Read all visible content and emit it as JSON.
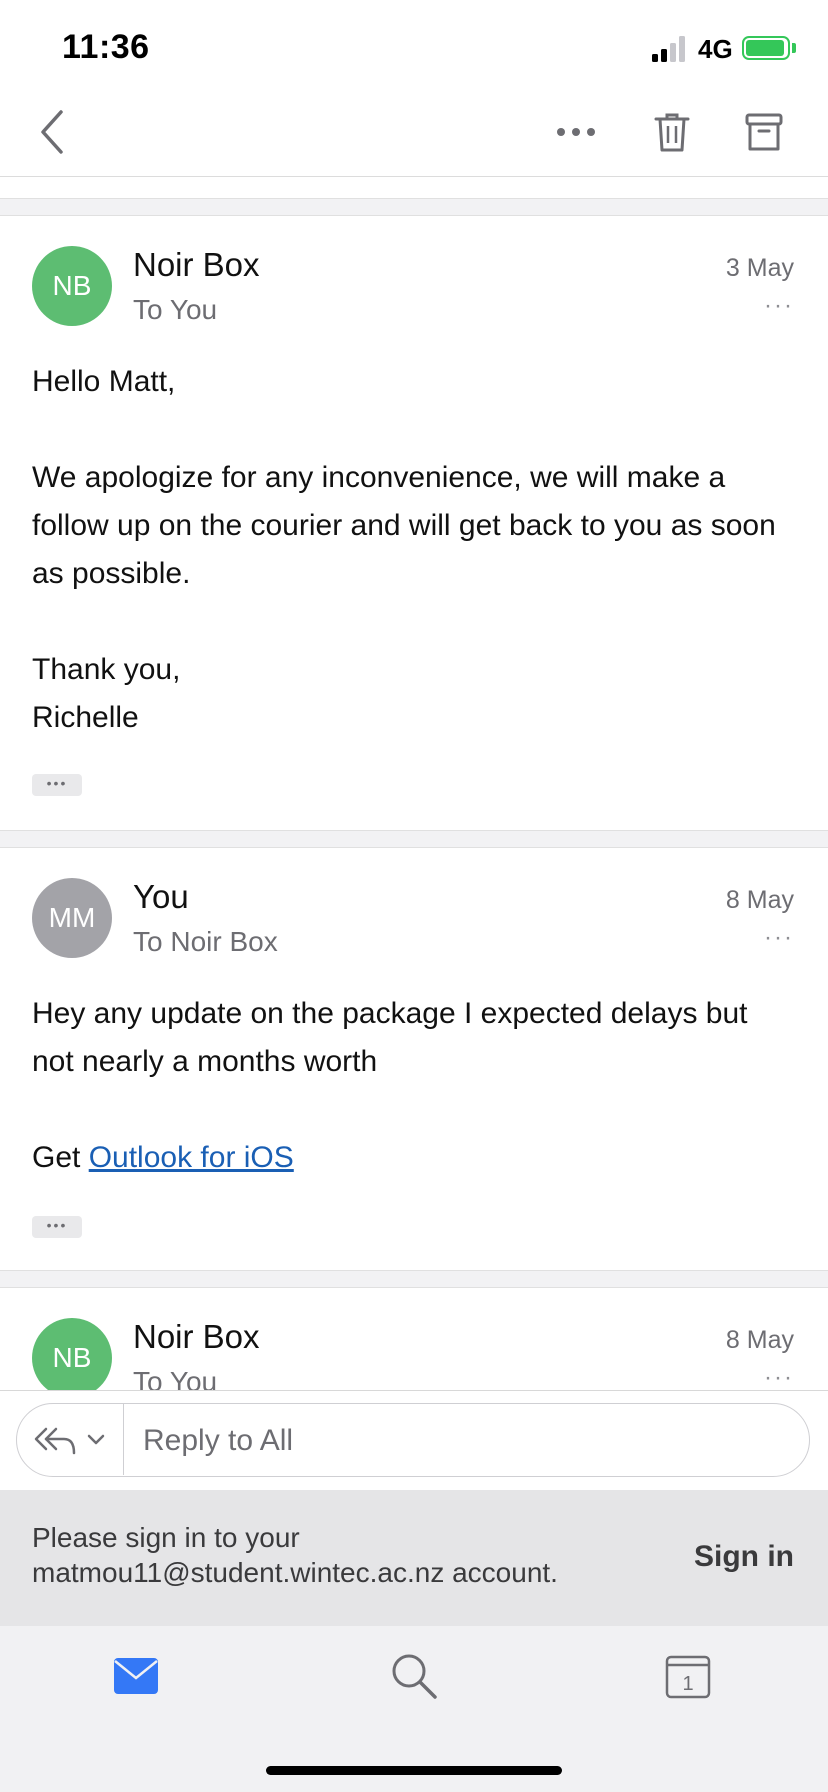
{
  "status_bar": {
    "time": "11:36",
    "network": "4G"
  },
  "toolbar": {
    "back_icon": "chevron-left-icon",
    "more_icon": "ellipsis-icon",
    "delete_icon": "trash-icon",
    "archive_icon": "archive-icon"
  },
  "messages": [
    {
      "avatar_initials": "NB",
      "avatar_color": "#5dbd72",
      "sender": "Noir Box",
      "recipient": "To You",
      "date": "3 May",
      "more": "···",
      "body": [
        "Hello Matt,",
        "We apologize for any inconvenience, we will make a follow up on the courier and will get back to you as soon as possible.",
        "Thank you,",
        "Richelle"
      ],
      "quoted_toggle": "•••"
    },
    {
      "avatar_initials": "MM",
      "avatar_color": "#a3a3a8",
      "sender": "You",
      "recipient": "To Noir Box",
      "date": "8 May",
      "more": "···",
      "body": [
        "Hey any update on the package I expected delays but not nearly a months worth"
      ],
      "signature_prefix": "Get ",
      "signature_link": "Outlook for iOS",
      "quoted_toggle": "•••"
    },
    {
      "avatar_initials": "NB",
      "avatar_color": "#5dbd72",
      "sender": "Noir Box",
      "recipient": "To You",
      "date": "8 May",
      "more": "···"
    }
  ],
  "reply": {
    "placeholder": "Reply to All",
    "action_icon": "reply-all-icon"
  },
  "signin_banner": {
    "line1": "Please sign in to your",
    "line2": "matmou11@student.wintec.ac.nz account.",
    "button": "Sign in"
  },
  "tabs": [
    {
      "name": "mail",
      "icon": "mail-icon",
      "active": true
    },
    {
      "name": "search",
      "icon": "search-icon",
      "active": false
    },
    {
      "name": "calendar",
      "icon": "calendar-icon",
      "date": "1",
      "active": false
    }
  ],
  "colors": {
    "accent": "#3478f6",
    "battery": "#34c759",
    "link": "#1a5fb4"
  }
}
